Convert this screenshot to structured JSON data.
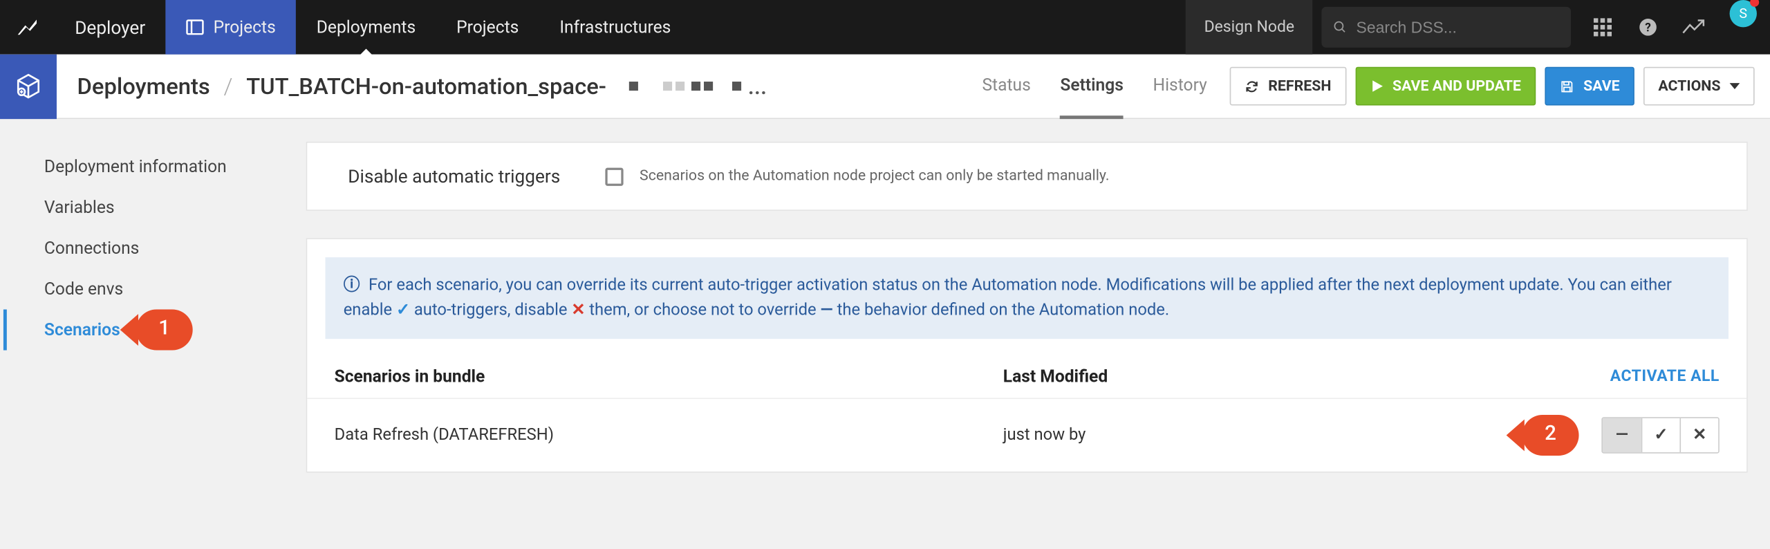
{
  "topnav": {
    "brand": "Deployer",
    "tabs": [
      "Projects",
      "Deployments",
      "Projects",
      "Infrastructures"
    ],
    "active_index": 0,
    "design_node": "Design Node",
    "search_placeholder": "Search DSS..."
  },
  "avatar": {
    "initial": "S"
  },
  "subheader": {
    "crumb_root": "Deployments",
    "crumb_current": "TUT_BATCH-on-automation_space-",
    "tabs": {
      "status": "Status",
      "settings": "Settings",
      "history": "History"
    },
    "active_tab": "settings",
    "buttons": {
      "refresh": "REFRESH",
      "save_update": "SAVE AND UPDATE",
      "save": "SAVE",
      "actions": "ACTIONS"
    }
  },
  "sidenav": {
    "items": [
      "Deployment information",
      "Variables",
      "Connections",
      "Code envs",
      "Scenarios"
    ],
    "active_index": 4
  },
  "callouts": {
    "c1": "1",
    "c2": "2"
  },
  "disable_triggers": {
    "label": "Disable automatic triggers",
    "hint": "Scenarios on the Automation node project can only be started manually."
  },
  "info": {
    "part1": "For each scenario, you can override its current auto-trigger activation status on the Automation node. Modifications will be applied after the next deployment update. You can either enable ",
    "enable_word": " auto-triggers, disable ",
    "disable_word": " them, or choose not to override ",
    "tail": " the behavior defined on the Automation node."
  },
  "table": {
    "header_name": "Scenarios in bundle",
    "header_modified": "Last Modified",
    "activate_all": "ACTIVATE ALL",
    "rows": [
      {
        "name": "Data Refresh (DATAREFRESH)",
        "modified": "just now by"
      }
    ]
  }
}
